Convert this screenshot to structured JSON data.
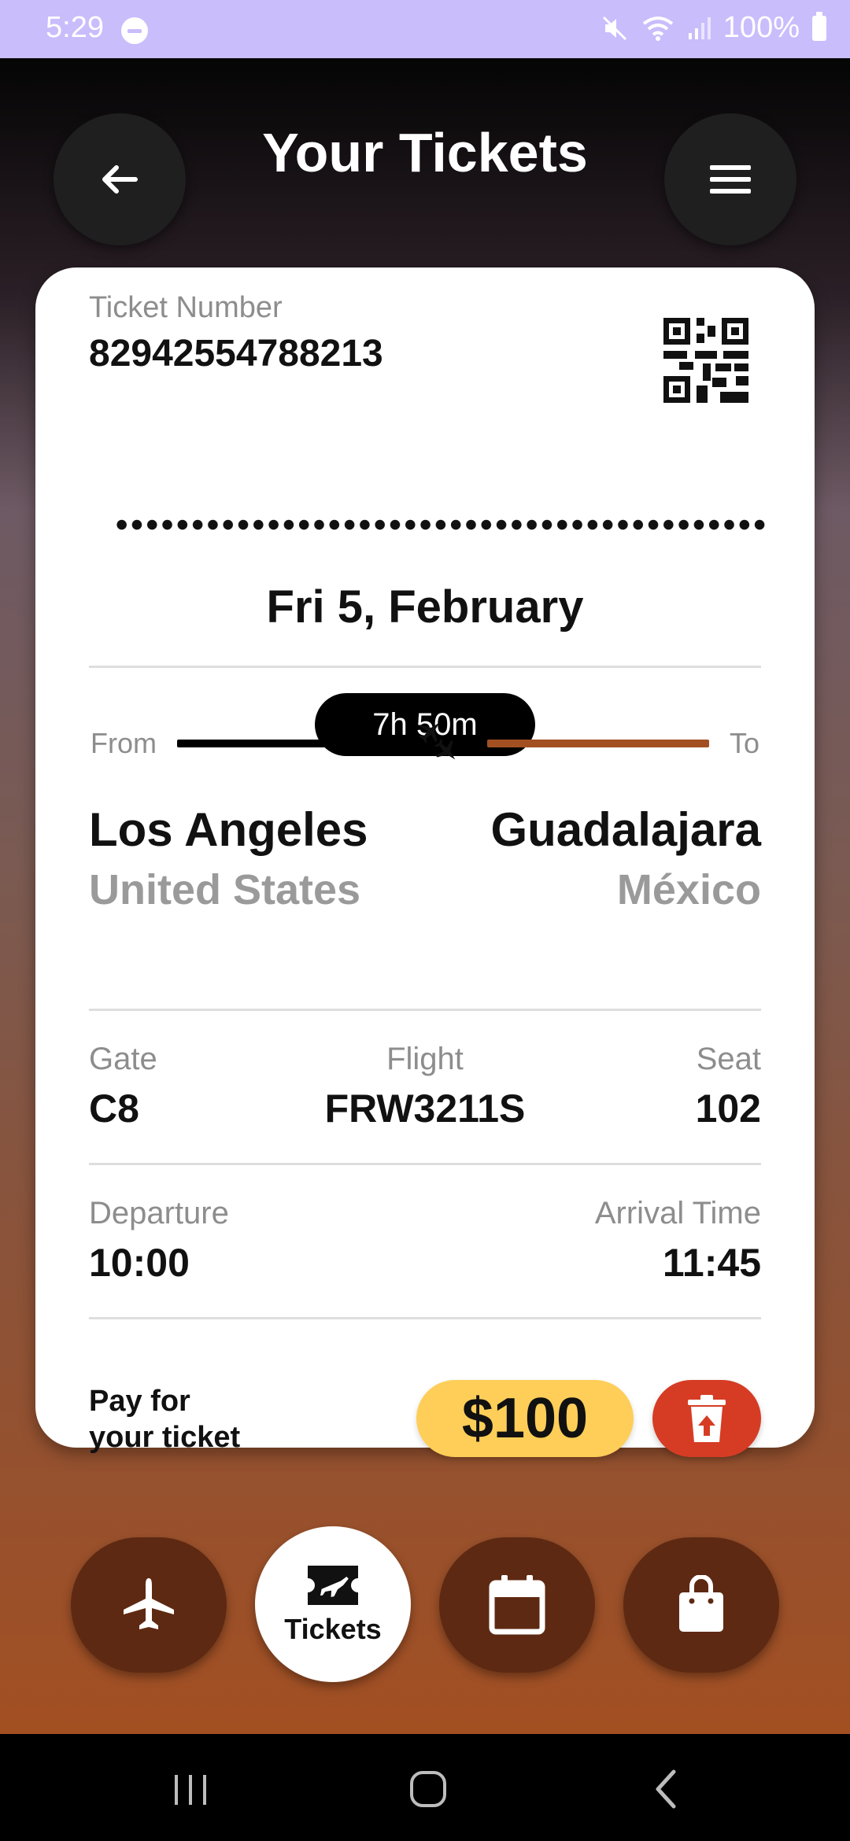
{
  "status_bar": {
    "time": "5:29",
    "battery": "100%"
  },
  "header": {
    "title": "Your Tickets"
  },
  "ticket": {
    "number_label": "Ticket Number",
    "number": "82942554788213",
    "date": "Fri 5, February",
    "duration": "7h 50m",
    "from_label": "From",
    "to_label": "To",
    "from_city": "Los Angeles",
    "from_country": "United States",
    "to_city": "Guadalajara",
    "to_country": "México",
    "gate_label": "Gate",
    "gate": "C8",
    "flight_label": "Flight",
    "flight": "FRW3211S",
    "seat_label": "Seat",
    "seat": "102",
    "departure_label": "Departure",
    "departure": "10:00",
    "arrival_label": "Arrival Time",
    "arrival": "11:45",
    "pay_line1": "Pay for",
    "pay_line2": "your ticket",
    "price": "$100"
  },
  "bottom_nav": {
    "tickets_label": "Tickets"
  },
  "colors": {
    "accent": "#a24f22",
    "price": "#fece58",
    "delete": "#d63c24",
    "nav": "#5e2912"
  }
}
